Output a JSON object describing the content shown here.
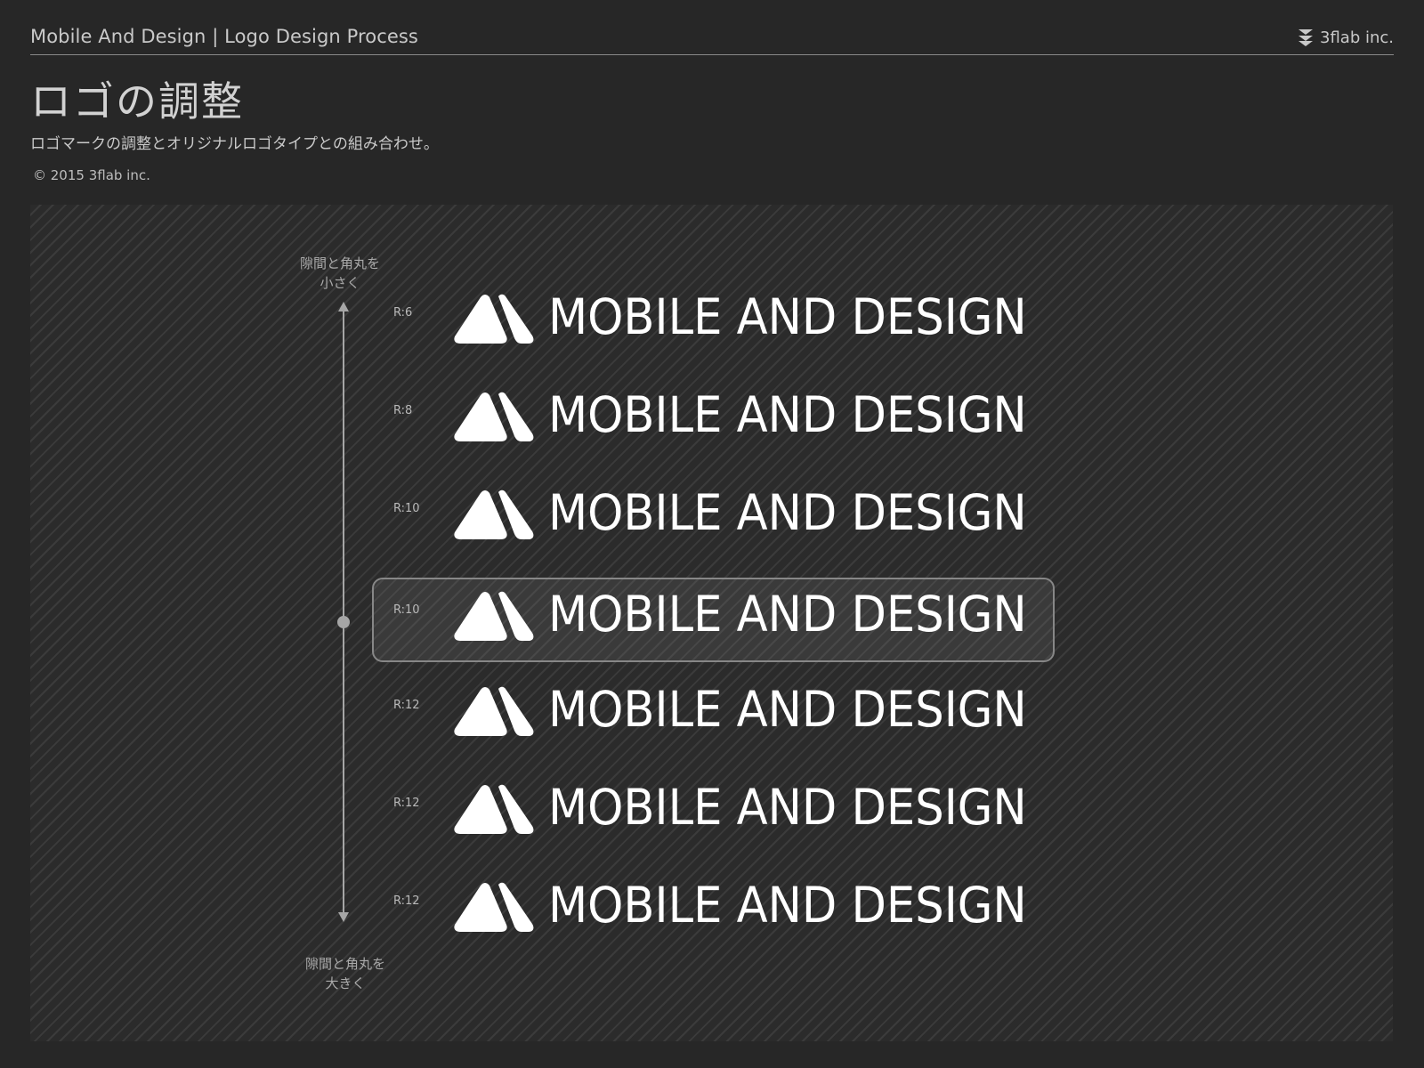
{
  "header": {
    "title": "Mobile And Design | Logo Design Process",
    "brand": "3flab inc."
  },
  "page": {
    "title": "ロゴの調整",
    "subtitle": "ロゴマークの調整とオリジナルロゴタイプとの組み合わせ。",
    "copyright": "© 2015 3flab inc."
  },
  "axis": {
    "top_label": [
      "隙間と角丸を",
      "小さく"
    ],
    "bottom_label": [
      "隙間と角丸を",
      "大きく"
    ]
  },
  "logo": {
    "wordmark": "MOBILE AND DESIGN"
  },
  "variants": [
    {
      "radius": "R:6"
    },
    {
      "radius": "R:8"
    },
    {
      "radius": "R:10"
    },
    {
      "radius": "R:10",
      "selected": true
    },
    {
      "radius": "R:12"
    },
    {
      "radius": "R:12"
    },
    {
      "radius": "R:12"
    }
  ],
  "colors": {
    "background": "#272727",
    "logo": "#ffffff",
    "text": "#cfcfcf"
  }
}
